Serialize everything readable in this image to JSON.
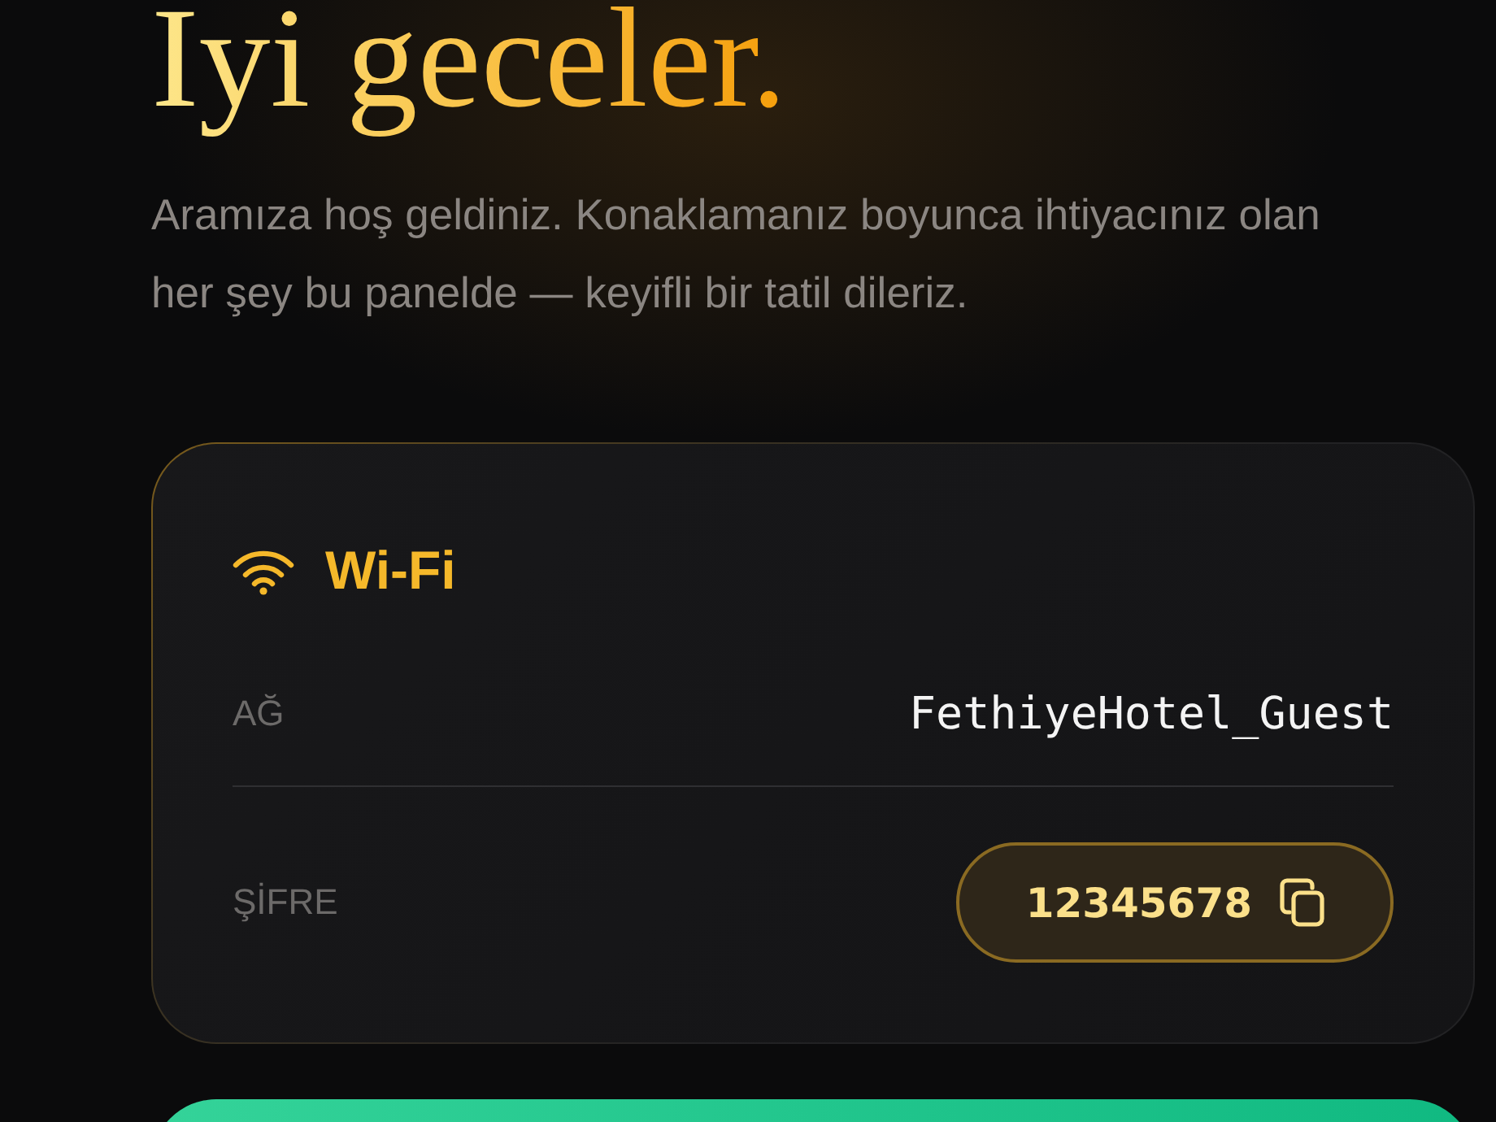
{
  "heading": "Iyi geceler.",
  "intro": "Aramıza hoş geldiniz. Konaklamanız boyunca ihtiyacınız olan her şey bu panelde — keyifli bir tatil dileriz.",
  "wifi": {
    "title": "Wi-Fi",
    "rows": [
      {
        "kind": "text",
        "label": "AĞ",
        "value": "FethiyeHotel_Guest"
      },
      {
        "kind": "copy",
        "label": "ŞİFRE",
        "value": "12345678"
      }
    ]
  }
}
